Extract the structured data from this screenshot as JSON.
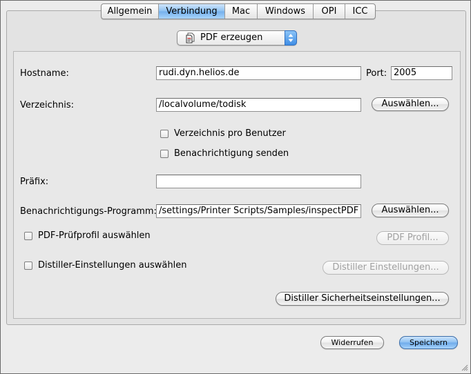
{
  "tabs": [
    {
      "label": "Allgemein",
      "active": false
    },
    {
      "label": "Verbindung",
      "active": true
    },
    {
      "label": "Mac",
      "active": false
    },
    {
      "label": "Windows",
      "active": false
    },
    {
      "label": "OPI",
      "active": false
    },
    {
      "label": "ICC",
      "active": false
    }
  ],
  "mode_popup": {
    "value": "PDF erzeugen",
    "icon": "pdf-document-icon"
  },
  "form": {
    "hostname_label": "Hostname:",
    "hostname_value": "rudi.dyn.helios.de",
    "port_label": "Port:",
    "port_value": "2005",
    "directory_label": "Verzeichnis:",
    "directory_value": "/localvolume/todisk",
    "directory_choose": "Auswählen...",
    "per_user_label": "Verzeichnis pro Benutzer",
    "per_user_checked": false,
    "notify_label": "Benachrichtigung senden",
    "notify_checked": false,
    "prefix_label": "Präfix:",
    "prefix_value": "",
    "notify_program_label": "Benachrichtigungs-Programm:",
    "notify_program_value": "/settings/Printer Scripts/Samples/inspectPDF",
    "notify_program_choose": "Auswählen...",
    "pdf_profile_check_label": "PDF-Prüfprofil auswählen",
    "pdf_profile_checked": false,
    "pdf_profile_button": "PDF Profil...",
    "distiller_check_label": "Distiller-Einstellungen auswählen",
    "distiller_checked": false,
    "distiller_button": "Distiller Einstellungen...",
    "distiller_security_button": "Distiller Sicherheitseinstellungen..."
  },
  "footer": {
    "revert_label": "Widerrufen",
    "save_label": "Speichern"
  },
  "colors": {
    "accent": "#74b0ec",
    "window_bg": "#ececec",
    "disabled_text": "#a0a0a0"
  }
}
